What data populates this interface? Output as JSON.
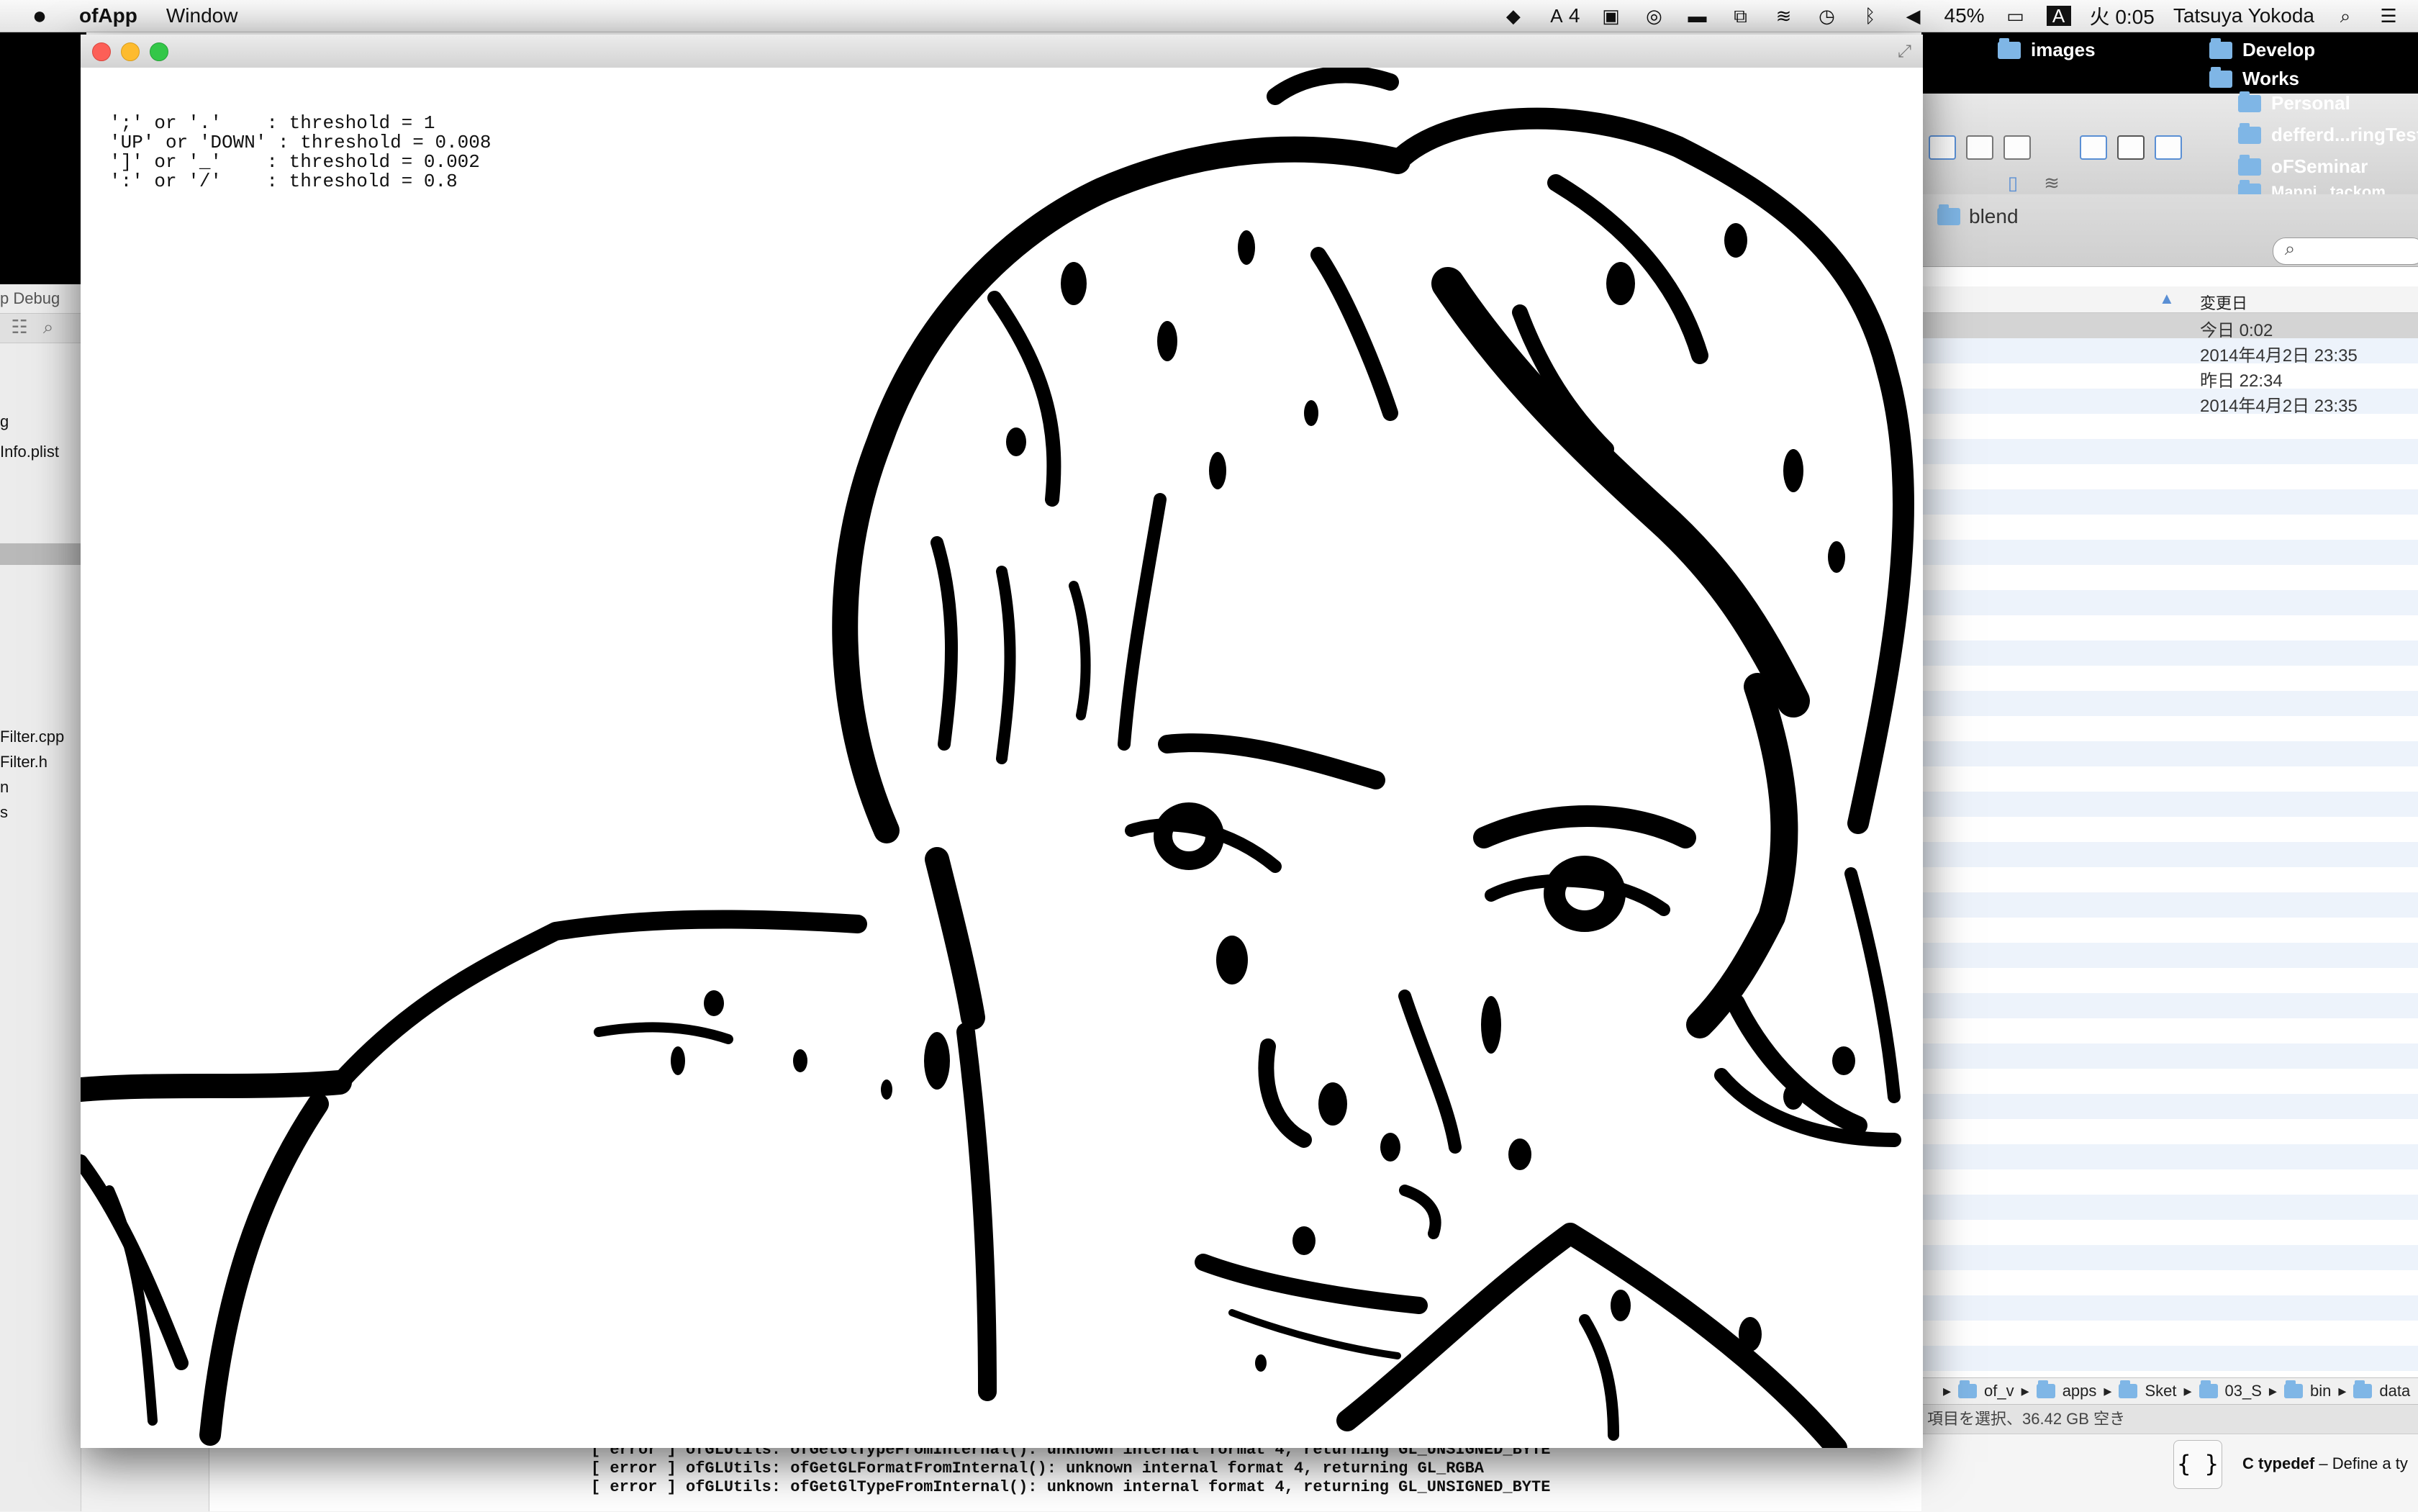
{
  "menubar": {
    "app_name": "ofApp",
    "menu_window": "Window",
    "battery": "45%",
    "clock": "火 0:05",
    "user": "Tatsuya Yokoda",
    "badge_count": "4"
  },
  "window": {
    "help_lines": [
      "';' or '.'    : threshold = 1",
      "'UP' or 'DOWN' : threshold = 0.008",
      "']' or '_'    : threshold = 0.002",
      "':' or '/'    : threshold = 0.8"
    ]
  },
  "xcode": {
    "scheme_fragment": "p Debug",
    "files": [
      "g",
      "Info.plist",
      "Filter.cpp",
      "Filter.h",
      "n",
      "s"
    ]
  },
  "console": {
    "lines": [
      "[ error ] ofGLUtils: ofGetGlTypeFromInternal(): unknown internal format 4, returning GL_UNSIGNED_BYTE",
      "[ error ] ofGLUtils: ofGetGLFormatFromInternal(): unknown internal format 4, returning GL_RGBA",
      "[ error ] ofGLUtils: ofGetGlTypeFromInternal(): unknown internal format 4, returning GL_UNSIGNED_BYTE"
    ]
  },
  "desktop": {
    "items": [
      "images",
      "Develop",
      "Works",
      "Personal",
      "defferd...ringTest",
      "oFSeminar",
      "Mappi...tackom"
    ]
  },
  "finder": {
    "folder_title": "blend",
    "column_date": "変更日",
    "rows": [
      "今日 0:02",
      "2014年4月2日 23:35",
      "昨日 22:34",
      "2014年4月2日 23:35"
    ],
    "path": [
      "of_v",
      "apps",
      "Sket",
      "03_S",
      "bin",
      "data"
    ],
    "status": "項目を選択、36.42 GB 空き"
  },
  "quickhelp": {
    "braces": "{ }",
    "title": "C typedef",
    "desc": " – Define a ty"
  },
  "colors": {
    "close": "#fc5f57",
    "minimize": "#fdbb2e",
    "zoom": "#33c748",
    "folder": "#7fb6e6"
  }
}
